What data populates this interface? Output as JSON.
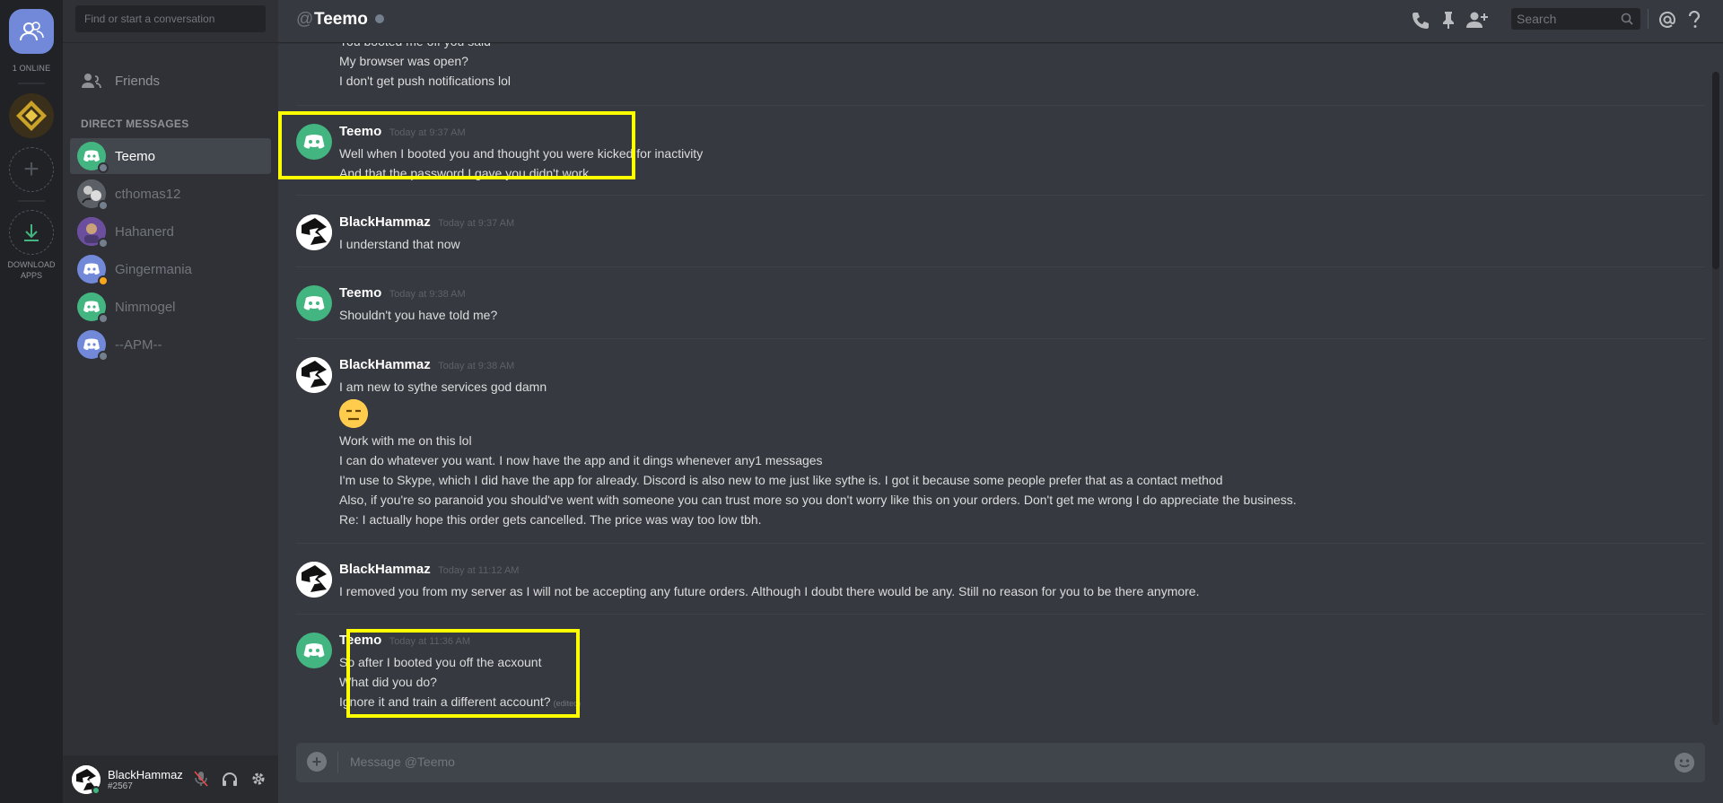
{
  "rail": {
    "online_count": "1 ONLINE",
    "download_label_1": "DOWNLOAD",
    "download_label_2": "APPS"
  },
  "sidebar": {
    "search_placeholder": "Find or start a conversation",
    "friends_label": "Friends",
    "dm_header": "DIRECT MESSAGES",
    "dms": [
      {
        "name": "Teemo",
        "status": "offline",
        "avatar_color": "#43b581"
      },
      {
        "name": "cthomas12",
        "status": "offline",
        "avatar_color": "#4f545c"
      },
      {
        "name": "Hahanerd",
        "status": "offline",
        "avatar_color": "#8a6cc2"
      },
      {
        "name": "Gingermania",
        "status": "idle",
        "avatar_color": "#7289da"
      },
      {
        "name": "Nimmogel",
        "status": "offline",
        "avatar_color": "#43b581"
      },
      {
        "name": "--APM--",
        "status": "offline",
        "avatar_color": "#7289da"
      }
    ]
  },
  "user_panel": {
    "username": "BlackHammaz",
    "tag": "#2567"
  },
  "header": {
    "at": "@",
    "channel_name": "Teemo",
    "search_placeholder": "Search"
  },
  "messages": {
    "top_group": {
      "lines": [
        "You booted me off you said",
        "My browser was open?",
        "I don't get push notifications lol"
      ]
    },
    "groups": [
      {
        "author": "Teemo",
        "time": "Today at 9:37 AM",
        "avatar": "discord-green",
        "lines": [
          "Well when I booted you and thought you were kicked for inactivity",
          "And that the password I gave you didn't work"
        ]
      },
      {
        "author": "BlackHammaz",
        "time": "Today at 9:37 AM",
        "avatar": "blackhammaz",
        "lines": [
          "I understand that now"
        ]
      },
      {
        "author": "Teemo",
        "time": "Today at 9:38 AM",
        "avatar": "discord-green",
        "lines": [
          "Shouldn't you have told me?"
        ]
      },
      {
        "author": "BlackHammaz",
        "time": "Today at 9:38 AM",
        "avatar": "blackhammaz",
        "lines": [
          "I am new to sythe services god damn",
          "Work with me on this lol",
          "I can do whatever you want. I now have the app and it dings whenever any1 messages",
          "I'm use to Skype, which I did have the app for already. Discord is also new to me just like sythe is. I got it because some people prefer that as a contact method",
          "Also, if you're so paranoid you should've went with someone you can trust more so you don't worry like this on your orders. Don't get me wrong I do appreciate the business.",
          "Re: I actually hope this order gets cancelled. The price was way too low tbh."
        ]
      },
      {
        "author": "BlackHammaz",
        "time": "Today at 11:12 AM",
        "avatar": "blackhammaz",
        "lines": [
          "I removed you from my server as I will not be accepting any future orders. Although I doubt there would be any. Still no reason for you to be there anymore."
        ]
      },
      {
        "author": "Teemo",
        "time": "Today at 11:36 AM",
        "avatar": "discord-green",
        "lines": [
          "So after I booted you off the acxount",
          "What did you do?",
          "Ignore it and train a different account?"
        ],
        "edited": "(edited)"
      }
    ]
  },
  "composer": {
    "placeholder": "Message @Teemo"
  },
  "colors": {
    "blurple": "#7289da",
    "green": "#43b581",
    "idle": "#faa61a",
    "offline": "#747f8d",
    "highlight": "#ffff00"
  }
}
